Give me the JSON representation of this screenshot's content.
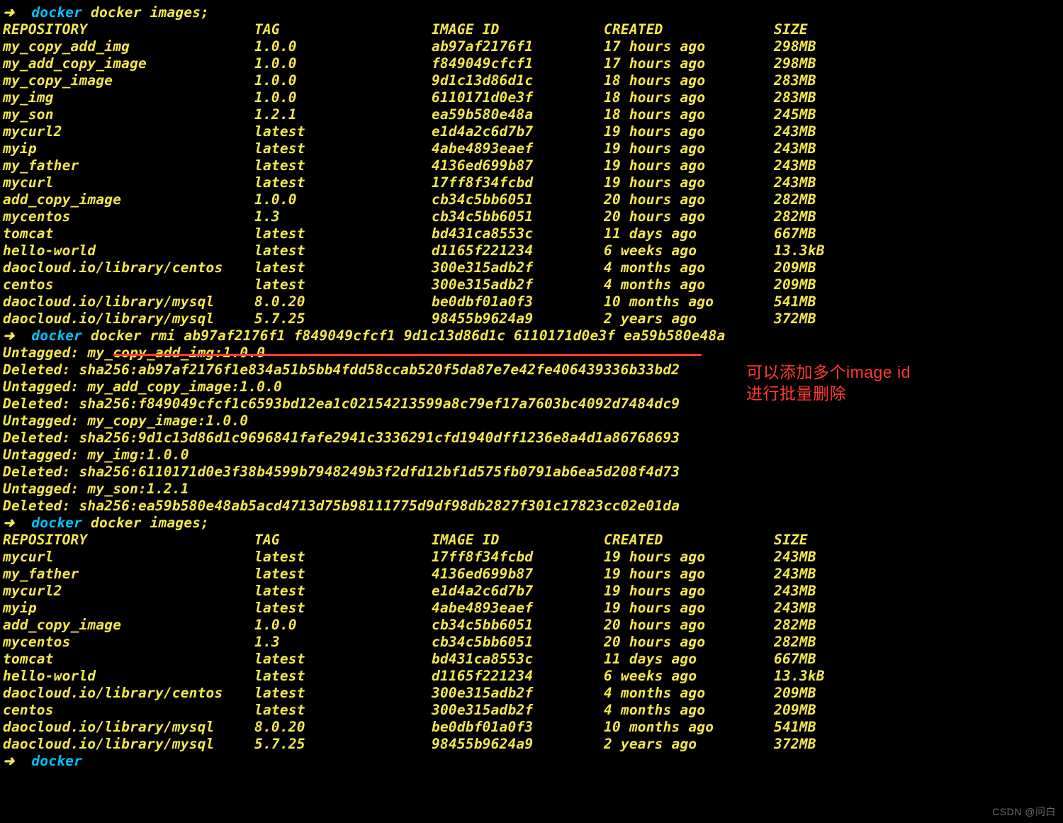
{
  "prompt_arrow": "➜",
  "prompt_label": "docker",
  "cmd_images": "docker images;",
  "cmd_rmi": "docker rmi ab97af2176f1 f849049cfcf1 9d1c13d86d1c 6110171d0e3f ea59b580e48a",
  "headers": {
    "repo": "REPOSITORY",
    "tag": "TAG",
    "id": "IMAGE ID",
    "created": "CREATED",
    "size": "SIZE"
  },
  "table1": [
    {
      "repo": "my_copy_add_img",
      "tag": "1.0.0",
      "id": "ab97af2176f1",
      "created": "17 hours ago",
      "size": "298MB"
    },
    {
      "repo": "my_add_copy_image",
      "tag": "1.0.0",
      "id": "f849049cfcf1",
      "created": "17 hours ago",
      "size": "298MB"
    },
    {
      "repo": "my_copy_image",
      "tag": "1.0.0",
      "id": "9d1c13d86d1c",
      "created": "18 hours ago",
      "size": "283MB"
    },
    {
      "repo": "my_img",
      "tag": "1.0.0",
      "id": "6110171d0e3f",
      "created": "18 hours ago",
      "size": "283MB"
    },
    {
      "repo": "my_son",
      "tag": "1.2.1",
      "id": "ea59b580e48a",
      "created": "18 hours ago",
      "size": "245MB"
    },
    {
      "repo": "mycurl2",
      "tag": "latest",
      "id": "e1d4a2c6d7b7",
      "created": "19 hours ago",
      "size": "243MB"
    },
    {
      "repo": "myip",
      "tag": "latest",
      "id": "4abe4893eaef",
      "created": "19 hours ago",
      "size": "243MB"
    },
    {
      "repo": "my_father",
      "tag": "latest",
      "id": "4136ed699b87",
      "created": "19 hours ago",
      "size": "243MB"
    },
    {
      "repo": "mycurl",
      "tag": "latest",
      "id": "17ff8f34fcbd",
      "created": "19 hours ago",
      "size": "243MB"
    },
    {
      "repo": "add_copy_image",
      "tag": "1.0.0",
      "id": "cb34c5bb6051",
      "created": "20 hours ago",
      "size": "282MB"
    },
    {
      "repo": "mycentos",
      "tag": "1.3",
      "id": "cb34c5bb6051",
      "created": "20 hours ago",
      "size": "282MB"
    },
    {
      "repo": "tomcat",
      "tag": "latest",
      "id": "bd431ca8553c",
      "created": "11 days ago",
      "size": "667MB"
    },
    {
      "repo": "hello-world",
      "tag": "latest",
      "id": "d1165f221234",
      "created": "6 weeks ago",
      "size": "13.3kB"
    },
    {
      "repo": "daocloud.io/library/centos",
      "tag": "latest",
      "id": "300e315adb2f",
      "created": "4 months ago",
      "size": "209MB"
    },
    {
      "repo": "centos",
      "tag": "latest",
      "id": "300e315adb2f",
      "created": "4 months ago",
      "size": "209MB"
    },
    {
      "repo": "daocloud.io/library/mysql",
      "tag": "8.0.20",
      "id": "be0dbf01a0f3",
      "created": "10 months ago",
      "size": "541MB"
    },
    {
      "repo": "daocloud.io/library/mysql",
      "tag": "5.7.25",
      "id": "98455b9624a9",
      "created": "2 years ago",
      "size": "372MB"
    }
  ],
  "rmi_output": [
    "Untagged: my_copy_add_img:1.0.0",
    "Deleted: sha256:ab97af2176f1e834a51b5bb4fdd58ccab520f5da87e7e42fe406439336b33bd2",
    "Untagged: my_add_copy_image:1.0.0",
    "Deleted: sha256:f849049cfcf1c6593bd12ea1c02154213599a8c79ef17a7603bc4092d7484dc9",
    "Untagged: my_copy_image:1.0.0",
    "Deleted: sha256:9d1c13d86d1c9696841fafe2941c3336291cfd1940dff1236e8a4d1a86768693",
    "Untagged: my_img:1.0.0",
    "Deleted: sha256:6110171d0e3f38b4599b7948249b3f2dfd12bf1d575fb0791ab6ea5d208f4d73",
    "Untagged: my_son:1.2.1",
    "Deleted: sha256:ea59b580e48ab5acd4713d75b98111775d9df98db2827f301c17823cc02e01da"
  ],
  "table2": [
    {
      "repo": "mycurl",
      "tag": "latest",
      "id": "17ff8f34fcbd",
      "created": "19 hours ago",
      "size": "243MB"
    },
    {
      "repo": "my_father",
      "tag": "latest",
      "id": "4136ed699b87",
      "created": "19 hours ago",
      "size": "243MB"
    },
    {
      "repo": "mycurl2",
      "tag": "latest",
      "id": "e1d4a2c6d7b7",
      "created": "19 hours ago",
      "size": "243MB"
    },
    {
      "repo": "myip",
      "tag": "latest",
      "id": "4abe4893eaef",
      "created": "19 hours ago",
      "size": "243MB"
    },
    {
      "repo": "add_copy_image",
      "tag": "1.0.0",
      "id": "cb34c5bb6051",
      "created": "20 hours ago",
      "size": "282MB"
    },
    {
      "repo": "mycentos",
      "tag": "1.3",
      "id": "cb34c5bb6051",
      "created": "20 hours ago",
      "size": "282MB"
    },
    {
      "repo": "tomcat",
      "tag": "latest",
      "id": "bd431ca8553c",
      "created": "11 days ago",
      "size": "667MB"
    },
    {
      "repo": "hello-world",
      "tag": "latest",
      "id": "d1165f221234",
      "created": "6 weeks ago",
      "size": "13.3kB"
    },
    {
      "repo": "daocloud.io/library/centos",
      "tag": "latest",
      "id": "300e315adb2f",
      "created": "4 months ago",
      "size": "209MB"
    },
    {
      "repo": "centos",
      "tag": "latest",
      "id": "300e315adb2f",
      "created": "4 months ago",
      "size": "209MB"
    },
    {
      "repo": "daocloud.io/library/mysql",
      "tag": "8.0.20",
      "id": "be0dbf01a0f3",
      "created": "10 months ago",
      "size": "541MB"
    },
    {
      "repo": "daocloud.io/library/mysql",
      "tag": "5.7.25",
      "id": "98455b9624a9",
      "created": "2 years ago",
      "size": "372MB"
    }
  ],
  "annotation": {
    "line1": "可以添加多个image id",
    "line2": "进行批量删除"
  },
  "watermark": "CSDN @问白"
}
